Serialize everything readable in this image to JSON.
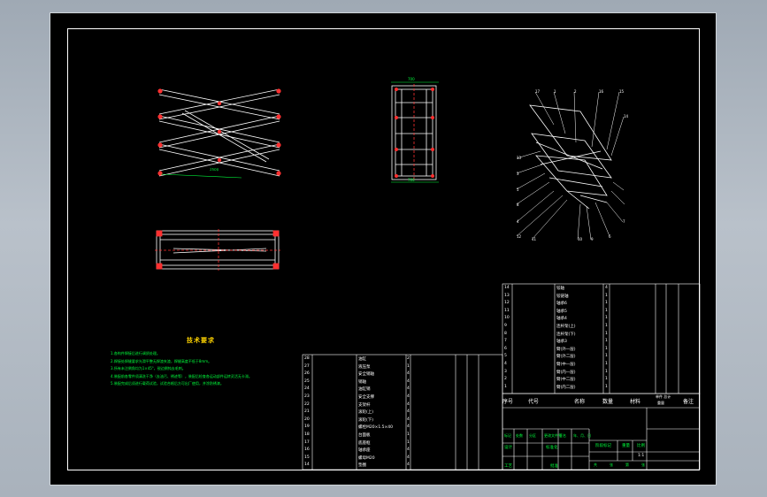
{
  "drawing": {
    "tech_title": "技术要求",
    "tech_notes": [
      "1.各构件焊接后进行调质处理。",
      "2.焊接处焊缝要求光滑平整无焊渣夹渣，焊缝高度不低于8mm。",
      "3.所有未注倒角均为1×45°，锐边倒钝去毛刺。",
      "4.装配前各零件须清洗干净（去油污、锈迹等），装配后检查各运动部件运转灵活无卡滞。",
      "5.装配完成后须进行载荷试验，试验合格后方可出厂使用，并涂防锈漆。"
    ],
    "dims": {
      "scissor_length": "2500",
      "top_width": "700",
      "bottom_width": "700"
    },
    "balloons_labels": [
      "17",
      "1",
      "2",
      "16",
      "15",
      "14",
      "13",
      "3",
      "5",
      "8",
      "4",
      "12",
      "11",
      "10",
      "9",
      "6",
      "7"
    ]
  },
  "parts_upper": [
    {
      "no": "14",
      "name": "铰轴",
      "qty": "4"
    },
    {
      "no": "13",
      "name": "铰链轴",
      "qty": "1"
    },
    {
      "no": "12",
      "name": "轴承6",
      "qty": "1"
    },
    {
      "no": "11",
      "name": "轴承5",
      "qty": "1"
    },
    {
      "no": "10",
      "name": "轴承4",
      "qty": "1"
    },
    {
      "no": "9",
      "name": "连杆架(上)",
      "qty": "1"
    },
    {
      "no": "8",
      "name": "连杆架(下)",
      "qty": "1"
    },
    {
      "no": "7",
      "name": "轴承3",
      "qty": "1"
    },
    {
      "no": "6",
      "name": "臂(外一层)",
      "qty": "1"
    },
    {
      "no": "5",
      "name": "臂(外二层)",
      "qty": "1"
    },
    {
      "no": "4",
      "name": "臂(中一层)",
      "qty": "1"
    },
    {
      "no": "3",
      "name": "臂(内一层)",
      "qty": "1"
    },
    {
      "no": "2",
      "name": "臂(中二层)",
      "qty": "1"
    },
    {
      "no": "1",
      "name": "臂(内二层)",
      "qty": "1"
    }
  ],
  "parts_lower": [
    {
      "no": "28",
      "name": "油缸",
      "qty": "2"
    },
    {
      "no": "27",
      "name": "液压泵",
      "qty": "1"
    },
    {
      "no": "26",
      "name": "安全销轴",
      "qty": "4"
    },
    {
      "no": "25",
      "name": "销轴",
      "qty": "4"
    },
    {
      "no": "24",
      "name": "油缸销",
      "qty": "4"
    },
    {
      "no": "23",
      "name": "安全支撑",
      "qty": "4"
    },
    {
      "no": "22",
      "name": "支架杆",
      "qty": "4"
    },
    {
      "no": "21",
      "name": "滚轮(上)",
      "qty": "4"
    },
    {
      "no": "20",
      "name": "滚轮(下)",
      "qty": "4"
    },
    {
      "no": "19",
      "name": "螺栓M20×1.5×40",
      "qty": "4"
    },
    {
      "no": "18",
      "name": "台面板",
      "qty": "1"
    },
    {
      "no": "17",
      "name": "底座框",
      "qty": "1"
    },
    {
      "no": "16",
      "name": "轴承座",
      "qty": "4"
    },
    {
      "no": "15",
      "name": "螺母M20",
      "qty": "4"
    },
    {
      "no": "14",
      "name": "垫圈",
      "qty": "4"
    }
  ],
  "header_row": {
    "no": "序号",
    "code": "代号",
    "name": "名称",
    "qty": "数量",
    "material": "材料",
    "unit_total": "单件 总计",
    "weight": "重量",
    "remark": "备注"
  },
  "title_block": {
    "row1": [
      "标记",
      "处数",
      "分区",
      "更改文件号",
      "签名",
      "年、月、日"
    ],
    "designer": "设计",
    "stage": "阶段标记",
    "weight": "重量",
    "scale": "比例",
    "scale_val": "1:1",
    "standard": "标准化",
    "process": "工艺",
    "approve": "批准",
    "sheet": [
      "共",
      "张",
      "第",
      "张"
    ]
  }
}
